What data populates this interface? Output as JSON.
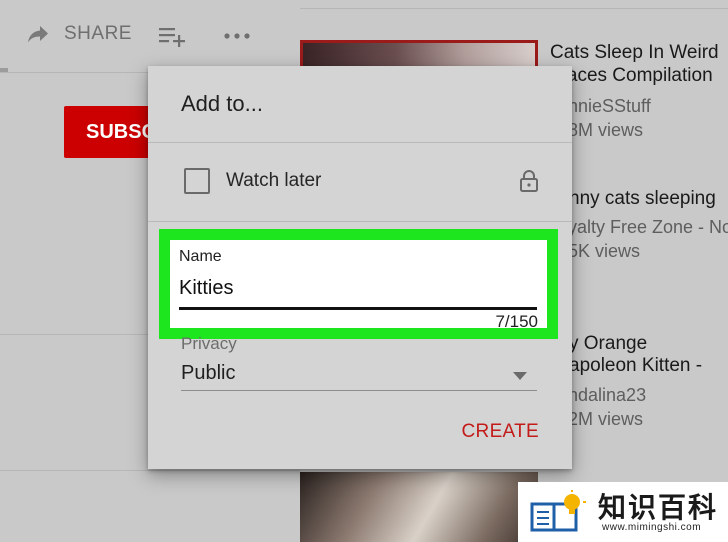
{
  "page": {
    "share_label": "SHARE",
    "subscribe_label": "SUBSCRIBE"
  },
  "videos": [
    {
      "title_line1": "Cats Sleep In Weird",
      "title_line2": "Places Compilation",
      "channel": "…nnieSStuff",
      "views": "…8M views"
    },
    {
      "title_line1": "…nny cats sleeping",
      "channel": "…yalty Free Zone - No",
      "views": "…5K views"
    },
    {
      "title_line1": "…y Orange",
      "title_line2": "…apoleon Kitten -",
      "channel": "…ndalina23",
      "views": "…2M views"
    }
  ],
  "dialog": {
    "title": "Add to...",
    "watch_later_label": "Watch later",
    "name_label": "Name",
    "name_value": "Kitties",
    "name_counter": "7/150",
    "privacy_label": "Privacy",
    "privacy_value": "Public",
    "create_label": "CREATE"
  },
  "watermark": {
    "text": "知识百科",
    "url": "www.mimingshi.com"
  },
  "colors": {
    "highlight": "#1ee61e",
    "subscribe": "#cc0000",
    "create": "#c31a1a"
  },
  "icons": [
    "share-icon",
    "add-to-playlist-icon",
    "more-icon",
    "lock-icon",
    "dropdown-caret-icon"
  ]
}
